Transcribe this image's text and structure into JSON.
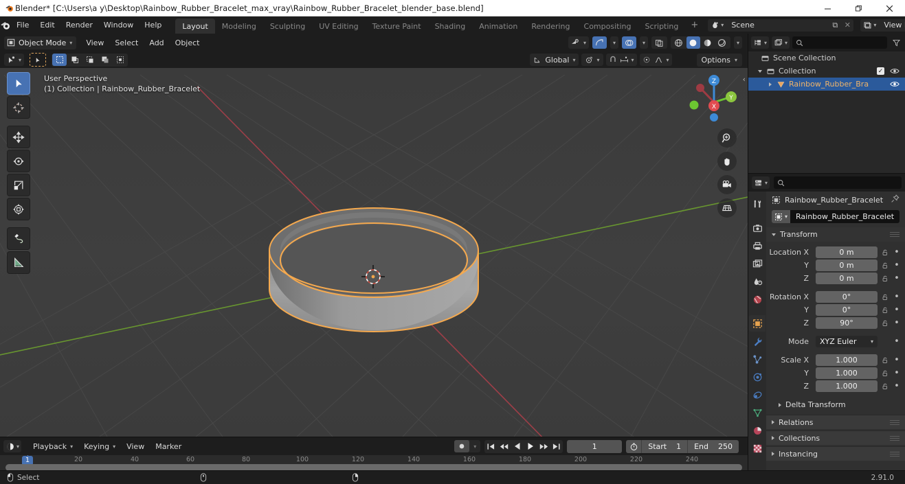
{
  "window": {
    "title": "Blender* [C:\\Users\\a y\\Desktop\\Rainbow_Rubber_Bracelet_max_vray\\Rainbow_Rubber_Bracelet_blender_base.blend]",
    "minimize_label": "–",
    "maximize_label": "❐",
    "close_label": "✕"
  },
  "topbar": {
    "menus": [
      "File",
      "Edit",
      "Render",
      "Window",
      "Help"
    ],
    "workspaces": [
      {
        "label": "Layout",
        "active": true
      },
      {
        "label": "Modeling",
        "active": false
      },
      {
        "label": "Sculpting",
        "active": false
      },
      {
        "label": "UV Editing",
        "active": false
      },
      {
        "label": "Texture Paint",
        "active": false
      },
      {
        "label": "Shading",
        "active": false
      },
      {
        "label": "Animation",
        "active": false
      },
      {
        "label": "Rendering",
        "active": false
      },
      {
        "label": "Compositing",
        "active": false
      },
      {
        "label": "Scripting",
        "active": false
      }
    ],
    "add_workspace": "+",
    "scene_name": "Scene",
    "view_layer_name": "View Layer",
    "new_label": "⧉",
    "unlink_label": "✕"
  },
  "viewport": {
    "mode": "Object Mode",
    "menus": [
      "View",
      "Select",
      "Add",
      "Object"
    ],
    "transform_orientation": "Global",
    "options_label": "Options",
    "overlay_line1": "User Perspective",
    "overlay_line2": "(1) Collection | Rainbow_Rubber_Bracelet",
    "gizmo_axes": {
      "x": "X",
      "y": "Y",
      "z": "Z"
    },
    "tools": [
      {
        "name": "tweak-tool",
        "active": true
      },
      {
        "name": "cursor-tool",
        "active": false
      },
      {
        "name": "move-tool",
        "active": false
      },
      {
        "name": "rotate-tool",
        "active": false
      },
      {
        "name": "scale-tool",
        "active": false
      },
      {
        "name": "transform-tool",
        "active": false
      },
      {
        "name": "annotate-tool",
        "active": false
      },
      {
        "name": "measure-tool",
        "active": false
      }
    ],
    "nav_buttons": [
      "zoom-icon",
      "pan-hand-icon",
      "camera-icon",
      "grid-ortho-icon"
    ],
    "shading_modes": [
      "wireframe",
      "solid",
      "material-preview",
      "rendered"
    ],
    "active_shading": "solid",
    "object_color": "#9d9d9d",
    "selection_outline_color": "#f5a94e",
    "grid_bg_color": "#3d3d3d",
    "x_axis_color": "#a33f49",
    "y_axis_color": "#6b9b2f"
  },
  "outliner": {
    "display_mode": "View Layer",
    "search_placeholder": "",
    "filter_label": "filter-icon",
    "rows": [
      {
        "label": "Scene Collection",
        "icon": "collection-icon",
        "depth": 0,
        "expandable": false,
        "selected": false,
        "checkbox": false,
        "eye": false
      },
      {
        "label": "Collection",
        "icon": "collection-icon",
        "depth": 1,
        "expandable": true,
        "expanded": true,
        "selected": false,
        "checkbox": true,
        "eye": true
      },
      {
        "label": "Rainbow_Rubber_Bra",
        "icon": "mesh-object-icon",
        "depth": 2,
        "expandable": true,
        "expanded": false,
        "selected": true,
        "checkbox": false,
        "eye": true
      }
    ]
  },
  "properties": {
    "search_placeholder": "",
    "breadcrumb_object": "Rainbow_Rubber_Bracelet",
    "object_name_field": "Rainbow_Rubber_Bracelet",
    "pin_label": "pin-icon",
    "tabs": [
      {
        "name": "tool-tab",
        "glyph": "tool",
        "active": false
      },
      {
        "name": "render-tab",
        "glyph": "render",
        "active": false
      },
      {
        "name": "output-tab",
        "glyph": "output",
        "active": false
      },
      {
        "name": "view-layer-tab",
        "glyph": "viewlayer",
        "active": false
      },
      {
        "name": "scene-tab",
        "glyph": "scene",
        "active": false
      },
      {
        "name": "world-tab",
        "glyph": "world",
        "active": false
      },
      {
        "name": "object-tab",
        "glyph": "object",
        "active": true
      },
      {
        "name": "modifier-tab",
        "glyph": "wrench",
        "active": false
      },
      {
        "name": "particles-tab",
        "glyph": "particles",
        "active": false
      },
      {
        "name": "physics-tab",
        "glyph": "physics",
        "active": false
      },
      {
        "name": "constraints-tab",
        "glyph": "constraints",
        "active": false
      },
      {
        "name": "data-tab",
        "glyph": "data",
        "active": false
      },
      {
        "name": "material-tab",
        "glyph": "material",
        "active": false
      },
      {
        "name": "texture-tab",
        "glyph": "texture",
        "active": false
      }
    ],
    "transform_panel": "Transform",
    "location": [
      {
        "label": "Location X",
        "value": "0 m"
      },
      {
        "label": "Y",
        "value": "0 m"
      },
      {
        "label": "Z",
        "value": "0 m"
      }
    ],
    "rotation": [
      {
        "label": "Rotation X",
        "value": "0°"
      },
      {
        "label": "Y",
        "value": "0°"
      },
      {
        "label": "Z",
        "value": "90°"
      }
    ],
    "mode_label": "Mode",
    "mode_value": "XYZ Euler",
    "scale": [
      {
        "label": "Scale X",
        "value": "1.000"
      },
      {
        "label": "Y",
        "value": "1.000"
      },
      {
        "label": "Z",
        "value": "1.000"
      }
    ],
    "subpanels": [
      "Delta Transform"
    ],
    "panels": [
      "Relations",
      "Collections",
      "Instancing"
    ]
  },
  "timeline": {
    "menus": [
      "Playback",
      "Keying",
      "View",
      "Marker"
    ],
    "playback_dropdowns": [
      "Playback",
      "Keying"
    ],
    "transport": [
      "jump-start-icon",
      "prev-keyframe-icon",
      "play-reverse-icon",
      "play-icon",
      "next-keyframe-icon",
      "jump-end-icon"
    ],
    "current_frame": "1",
    "start_label": "Start",
    "start_value": "1",
    "end_label": "End",
    "end_value": "250",
    "ruler_ticks": [
      "20",
      "40",
      "60",
      "80",
      "100",
      "120",
      "140",
      "160",
      "180",
      "200",
      "220",
      "240"
    ],
    "playhead_frame": "1"
  },
  "statusbar": {
    "mouse_left_label": "Select",
    "mouse_middle_label": "",
    "mouse_right_label": "",
    "version": "2.91.0"
  }
}
